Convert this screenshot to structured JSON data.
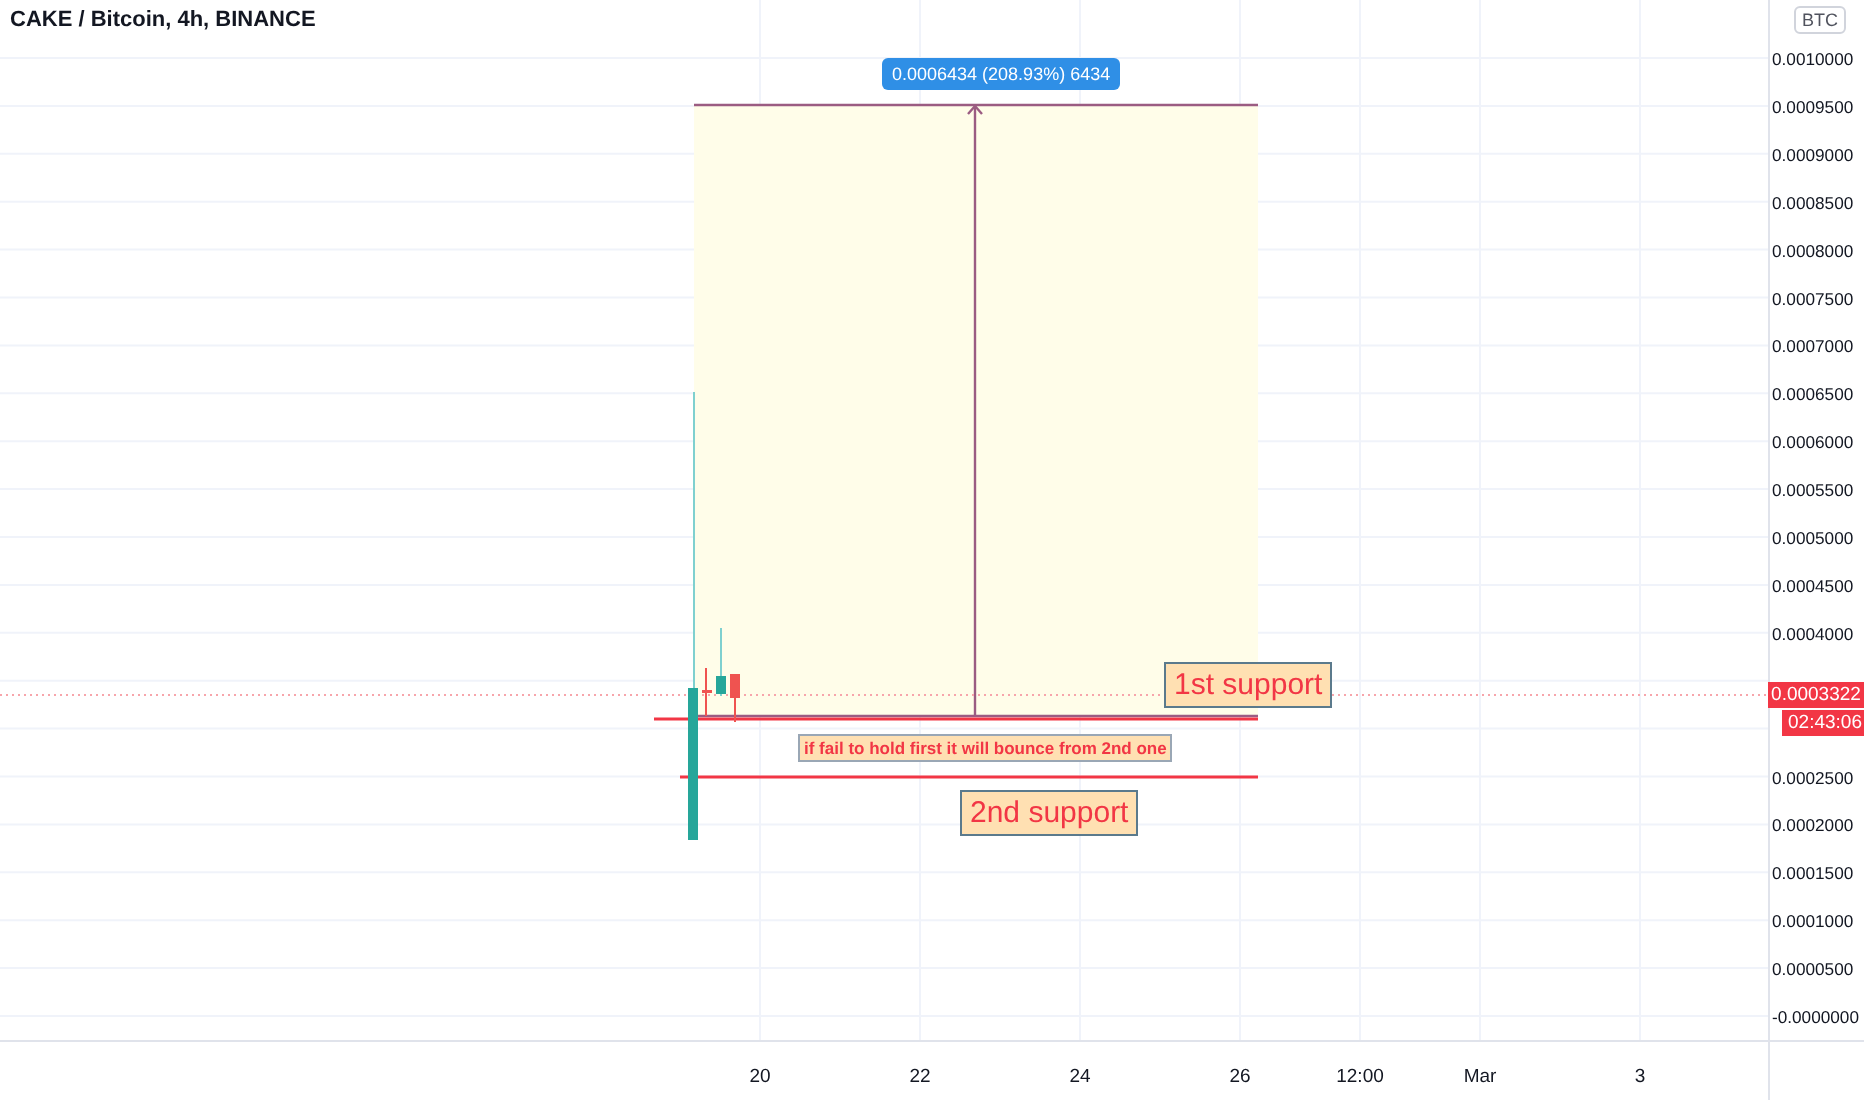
{
  "header": {
    "title": "CAKE / Bitcoin, 4h, BINANCE"
  },
  "price_axis": {
    "currency": "BTC",
    "labels": [
      "0.0010000",
      "0.0009500",
      "0.0009000",
      "0.0008500",
      "0.0008000",
      "0.0007500",
      "0.0007000",
      "0.0006500",
      "0.0006000",
      "0.0005500",
      "0.0005000",
      "0.0004500",
      "0.0004000",
      "0.0002500",
      "0.0002000",
      "0.0001500",
      "0.0001000",
      "0.0000500",
      "-0.0000000"
    ],
    "last_price": "0.0003322",
    "countdown": "02:43:06"
  },
  "time_axis": {
    "labels": [
      "20",
      "22",
      "24",
      "26",
      "12:00",
      "Mar",
      "3"
    ]
  },
  "drawings": {
    "measure_label": "0.0006434 (208.93%) 6434",
    "notes": [
      {
        "kind": "large",
        "text": "1st support"
      },
      {
        "kind": "small",
        "text": "if fail to hold first it will bounce from 2nd one"
      },
      {
        "kind": "large",
        "text": "2nd support"
      }
    ]
  }
}
